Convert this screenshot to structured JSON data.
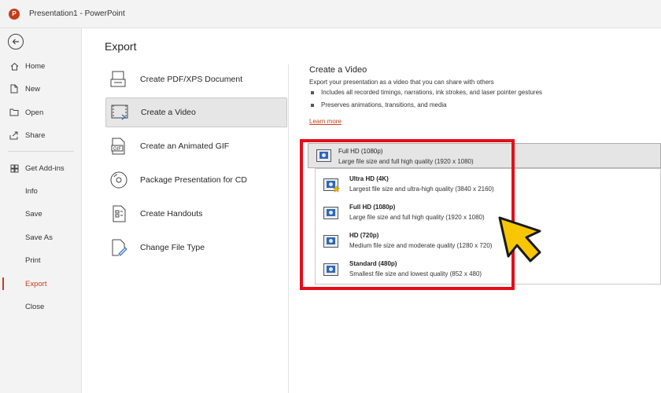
{
  "window": {
    "title": "Presentation1 - PowerPoint"
  },
  "sidebar": {
    "items": [
      {
        "label": "Home",
        "icon": "home-icon"
      },
      {
        "label": "New",
        "icon": "new-file-icon"
      },
      {
        "label": "Open",
        "icon": "open-folder-icon"
      },
      {
        "label": "Share",
        "icon": "share-icon"
      },
      {
        "label": "Get Add-ins",
        "icon": "add-ins-icon"
      },
      {
        "label": "Info"
      },
      {
        "label": "Save"
      },
      {
        "label": "Save As"
      },
      {
        "label": "Print"
      },
      {
        "label": "Export",
        "active": true
      },
      {
        "label": "Close"
      }
    ]
  },
  "main": {
    "title": "Export",
    "options": [
      {
        "label": "Create PDF/XPS Document",
        "icon": "pdf-document-icon"
      },
      {
        "label": "Create a Video",
        "icon": "video-icon",
        "selected": true
      },
      {
        "label": "Create an Animated GIF",
        "icon": "gif-icon"
      },
      {
        "label": "Package Presentation for CD",
        "icon": "cd-icon"
      },
      {
        "label": "Create Handouts",
        "icon": "handouts-icon"
      },
      {
        "label": "Change File Type",
        "icon": "change-file-type-icon"
      }
    ]
  },
  "video_panel": {
    "title": "Create a Video",
    "description": "Export your presentation as a video that you can share with others",
    "bullets": [
      "Includes all recorded timings, narrations, ink strokes, and laser pointer gestures",
      "Preserves animations, transitions, and media"
    ],
    "learn_more": "Learn more",
    "quality_selected": {
      "title": "Full HD (1080p)",
      "desc": "Large file size and full high quality (1920 x 1080)"
    },
    "quality_options": [
      {
        "title": "Ultra HD (4K)",
        "desc": "Largest file size and ultra-high quality (3840 x 2160)",
        "icon": "ultra-hd-icon"
      },
      {
        "title": "Full HD (1080p)",
        "desc": "Large file size and full high quality (1920 x 1080)",
        "icon": "full-hd-icon"
      },
      {
        "title": "HD (720p)",
        "desc": "Medium file size and moderate quality (1280 x 720)",
        "icon": "hd-icon"
      },
      {
        "title": "Standard (480p)",
        "desc": "Smallest file size and lowest quality (852 x 480)",
        "icon": "standard-quality-icon"
      }
    ]
  },
  "colors": {
    "accent": "#c43e1c",
    "highlight_frame": "#e30e19",
    "pointer": "#f7c600"
  }
}
